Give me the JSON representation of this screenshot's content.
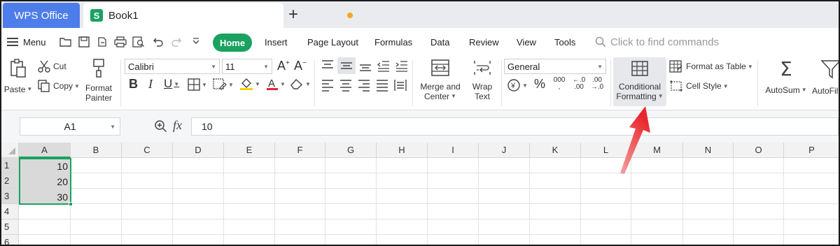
{
  "titlebar": {
    "app_tab": "WPS Office",
    "doc_tab": "Book1",
    "doc_icon_letter": "S",
    "new_tab_symbol": "+"
  },
  "menubar": {
    "menu_label": "Menu",
    "tabs": [
      "Home",
      "Insert",
      "Page Layout",
      "Formulas",
      "Data",
      "Review",
      "View",
      "Tools"
    ],
    "active_tab": "Home",
    "search_placeholder": "Click to find commands"
  },
  "ribbon": {
    "paste": "Paste",
    "cut": "Cut",
    "copy": "Copy",
    "format_painter_1": "Format",
    "format_painter_2": "Painter",
    "font_name": "Calibri",
    "font_size": "11",
    "merge_1": "Merge and",
    "merge_2": "Center",
    "wrap_1": "Wrap",
    "wrap_2": "Text",
    "number_format": "General",
    "cond_1": "Conditional",
    "cond_2": "Formatting",
    "format_as_table": "Format as Table",
    "cell_style": "Cell Style",
    "autosum": "AutoSum",
    "autofilter": "AutoFilter",
    "currency_symbol": "¥",
    "percent": "%",
    "thousands": "000"
  },
  "formula_bar": {
    "name_box": "A1",
    "fx": "fx",
    "value": "10"
  },
  "grid": {
    "columns": [
      "A",
      "B",
      "C",
      "D",
      "E",
      "F",
      "G",
      "H",
      "I",
      "J",
      "K",
      "L",
      "M",
      "N",
      "O",
      "P"
    ],
    "rows": [
      "1",
      "2",
      "3",
      "4",
      "5",
      "6"
    ],
    "cells_A": [
      "10",
      "20",
      "30"
    ]
  },
  "colors": {
    "accent_green": "#1aa260",
    "wps_blue": "#4d7dea",
    "annotation_red": "#e8252b"
  }
}
